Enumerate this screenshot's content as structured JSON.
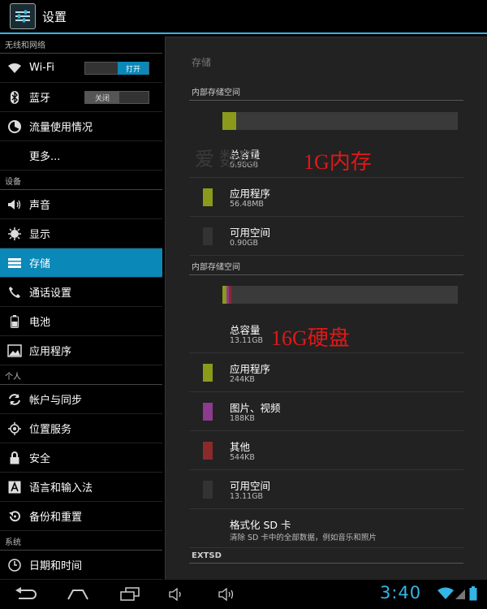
{
  "topbar": {
    "title": "设置",
    "icon": "settings-sliders-icon"
  },
  "sidebar": {
    "sections": {
      "wireless": "无线和网络",
      "device": "设备",
      "personal": "个人",
      "system": "系统"
    },
    "items": [
      {
        "label": "Wi-Fi",
        "icon": "wifi-icon",
        "toggle": "打开",
        "toggle_state": "on"
      },
      {
        "label": "蓝牙",
        "icon": "bluetooth-icon",
        "toggle": "关闭",
        "toggle_state": "off"
      },
      {
        "label": "流量使用情况",
        "icon": "data-usage-icon"
      },
      {
        "label": "更多...",
        "icon": ""
      },
      {
        "label": "声音",
        "icon": "speaker-icon"
      },
      {
        "label": "显示",
        "icon": "brightness-icon"
      },
      {
        "label": "存储",
        "icon": "storage-icon",
        "selected": true
      },
      {
        "label": "通话设置",
        "icon": "phone-icon"
      },
      {
        "label": "电池",
        "icon": "battery-icon"
      },
      {
        "label": "应用程序",
        "icon": "apps-icon"
      },
      {
        "label": "帐户与同步",
        "icon": "sync-icon"
      },
      {
        "label": "位置服务",
        "icon": "location-icon"
      },
      {
        "label": "安全",
        "icon": "lock-icon"
      },
      {
        "label": "语言和输入法",
        "icon": "keyboard-icon"
      },
      {
        "label": "备份和重置",
        "icon": "backup-icon"
      },
      {
        "label": "日期和时间",
        "icon": "clock-icon"
      }
    ]
  },
  "storage": {
    "title": "存储",
    "internal1": {
      "header": "内部存储空间",
      "bar": [
        {
          "color": "#8b9a1a",
          "fraction": 0.06
        }
      ],
      "total_label": "总容量",
      "total_value": "0.98GB",
      "apps_label": "应用程序",
      "apps_value": "56.48MB",
      "free_label": "可用空间",
      "free_value": "0.90GB"
    },
    "internal2": {
      "header": "内部存储空间",
      "bar": [
        {
          "color": "#8b9a1a",
          "fraction": 0.018
        },
        {
          "color": "#8e3a8e",
          "fraction": 0.012
        },
        {
          "color": "#8a2a2a",
          "fraction": 0.012
        }
      ],
      "total_label": "总容量",
      "total_value": "13.11GB",
      "apps_label": "应用程序",
      "apps_value": "244KB",
      "media_label": "图片、视频",
      "media_value": "188KB",
      "other_label": "其他",
      "other_value": "544KB",
      "free_label": "可用空间",
      "free_value": "13.11GB",
      "format_label": "格式化 SD 卡",
      "format_desc": "清除 SD 卡中的全部数据，例如音乐和照片"
    },
    "extsd_header": "EXTSD"
  },
  "annotations": {
    "ram": "1G内存",
    "disk": "16G硬盘",
    "watermark": "爱        数码"
  },
  "status": {
    "time": "3:40"
  },
  "colors": {
    "accent": "#33b5e5",
    "selected": "#0a88b8",
    "apps": "#8b9a1a",
    "media": "#8e3a8e",
    "other": "#8a2a2a",
    "free": "#333333",
    "annotation": "#e01818"
  }
}
